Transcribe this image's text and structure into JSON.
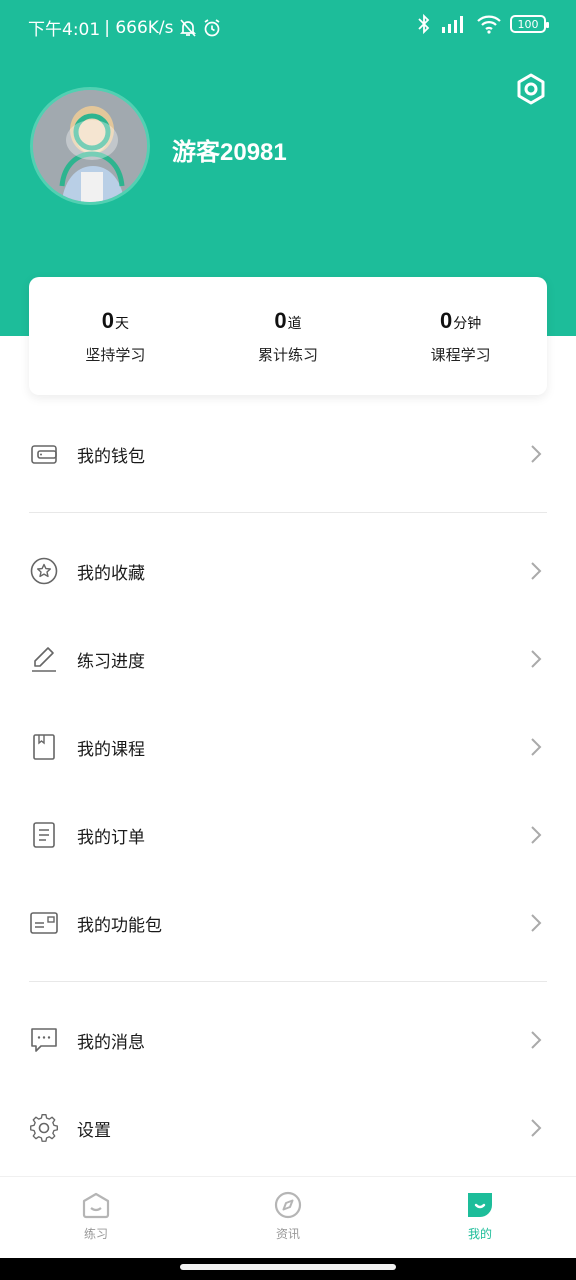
{
  "status_bar": {
    "time": "下午4:01",
    "speed": "| 666K/s",
    "battery": "100"
  },
  "profile": {
    "username": "游客20981"
  },
  "stats": [
    {
      "value": "0",
      "unit": "天",
      "label": "坚持学习"
    },
    {
      "value": "0",
      "unit": "道",
      "label": "累计练习"
    },
    {
      "value": "0",
      "unit": "分钟",
      "label": "课程学习"
    }
  ],
  "menu": {
    "wallet": "我的钱包",
    "favorites": "我的收藏",
    "progress": "练习进度",
    "courses": "我的课程",
    "orders": "我的订单",
    "packages": "我的功能包",
    "messages": "我的消息",
    "settings": "设置"
  },
  "bottom_nav": [
    {
      "label": "练习",
      "icon": "practice-icon",
      "active": false
    },
    {
      "label": "资讯",
      "icon": "compass-icon",
      "active": false
    },
    {
      "label": "我的",
      "icon": "profile-icon",
      "active": true
    }
  ],
  "colors": {
    "brand": "#1dbd9a",
    "icon_gray": "#666666",
    "nav_inactive": "#999999"
  }
}
